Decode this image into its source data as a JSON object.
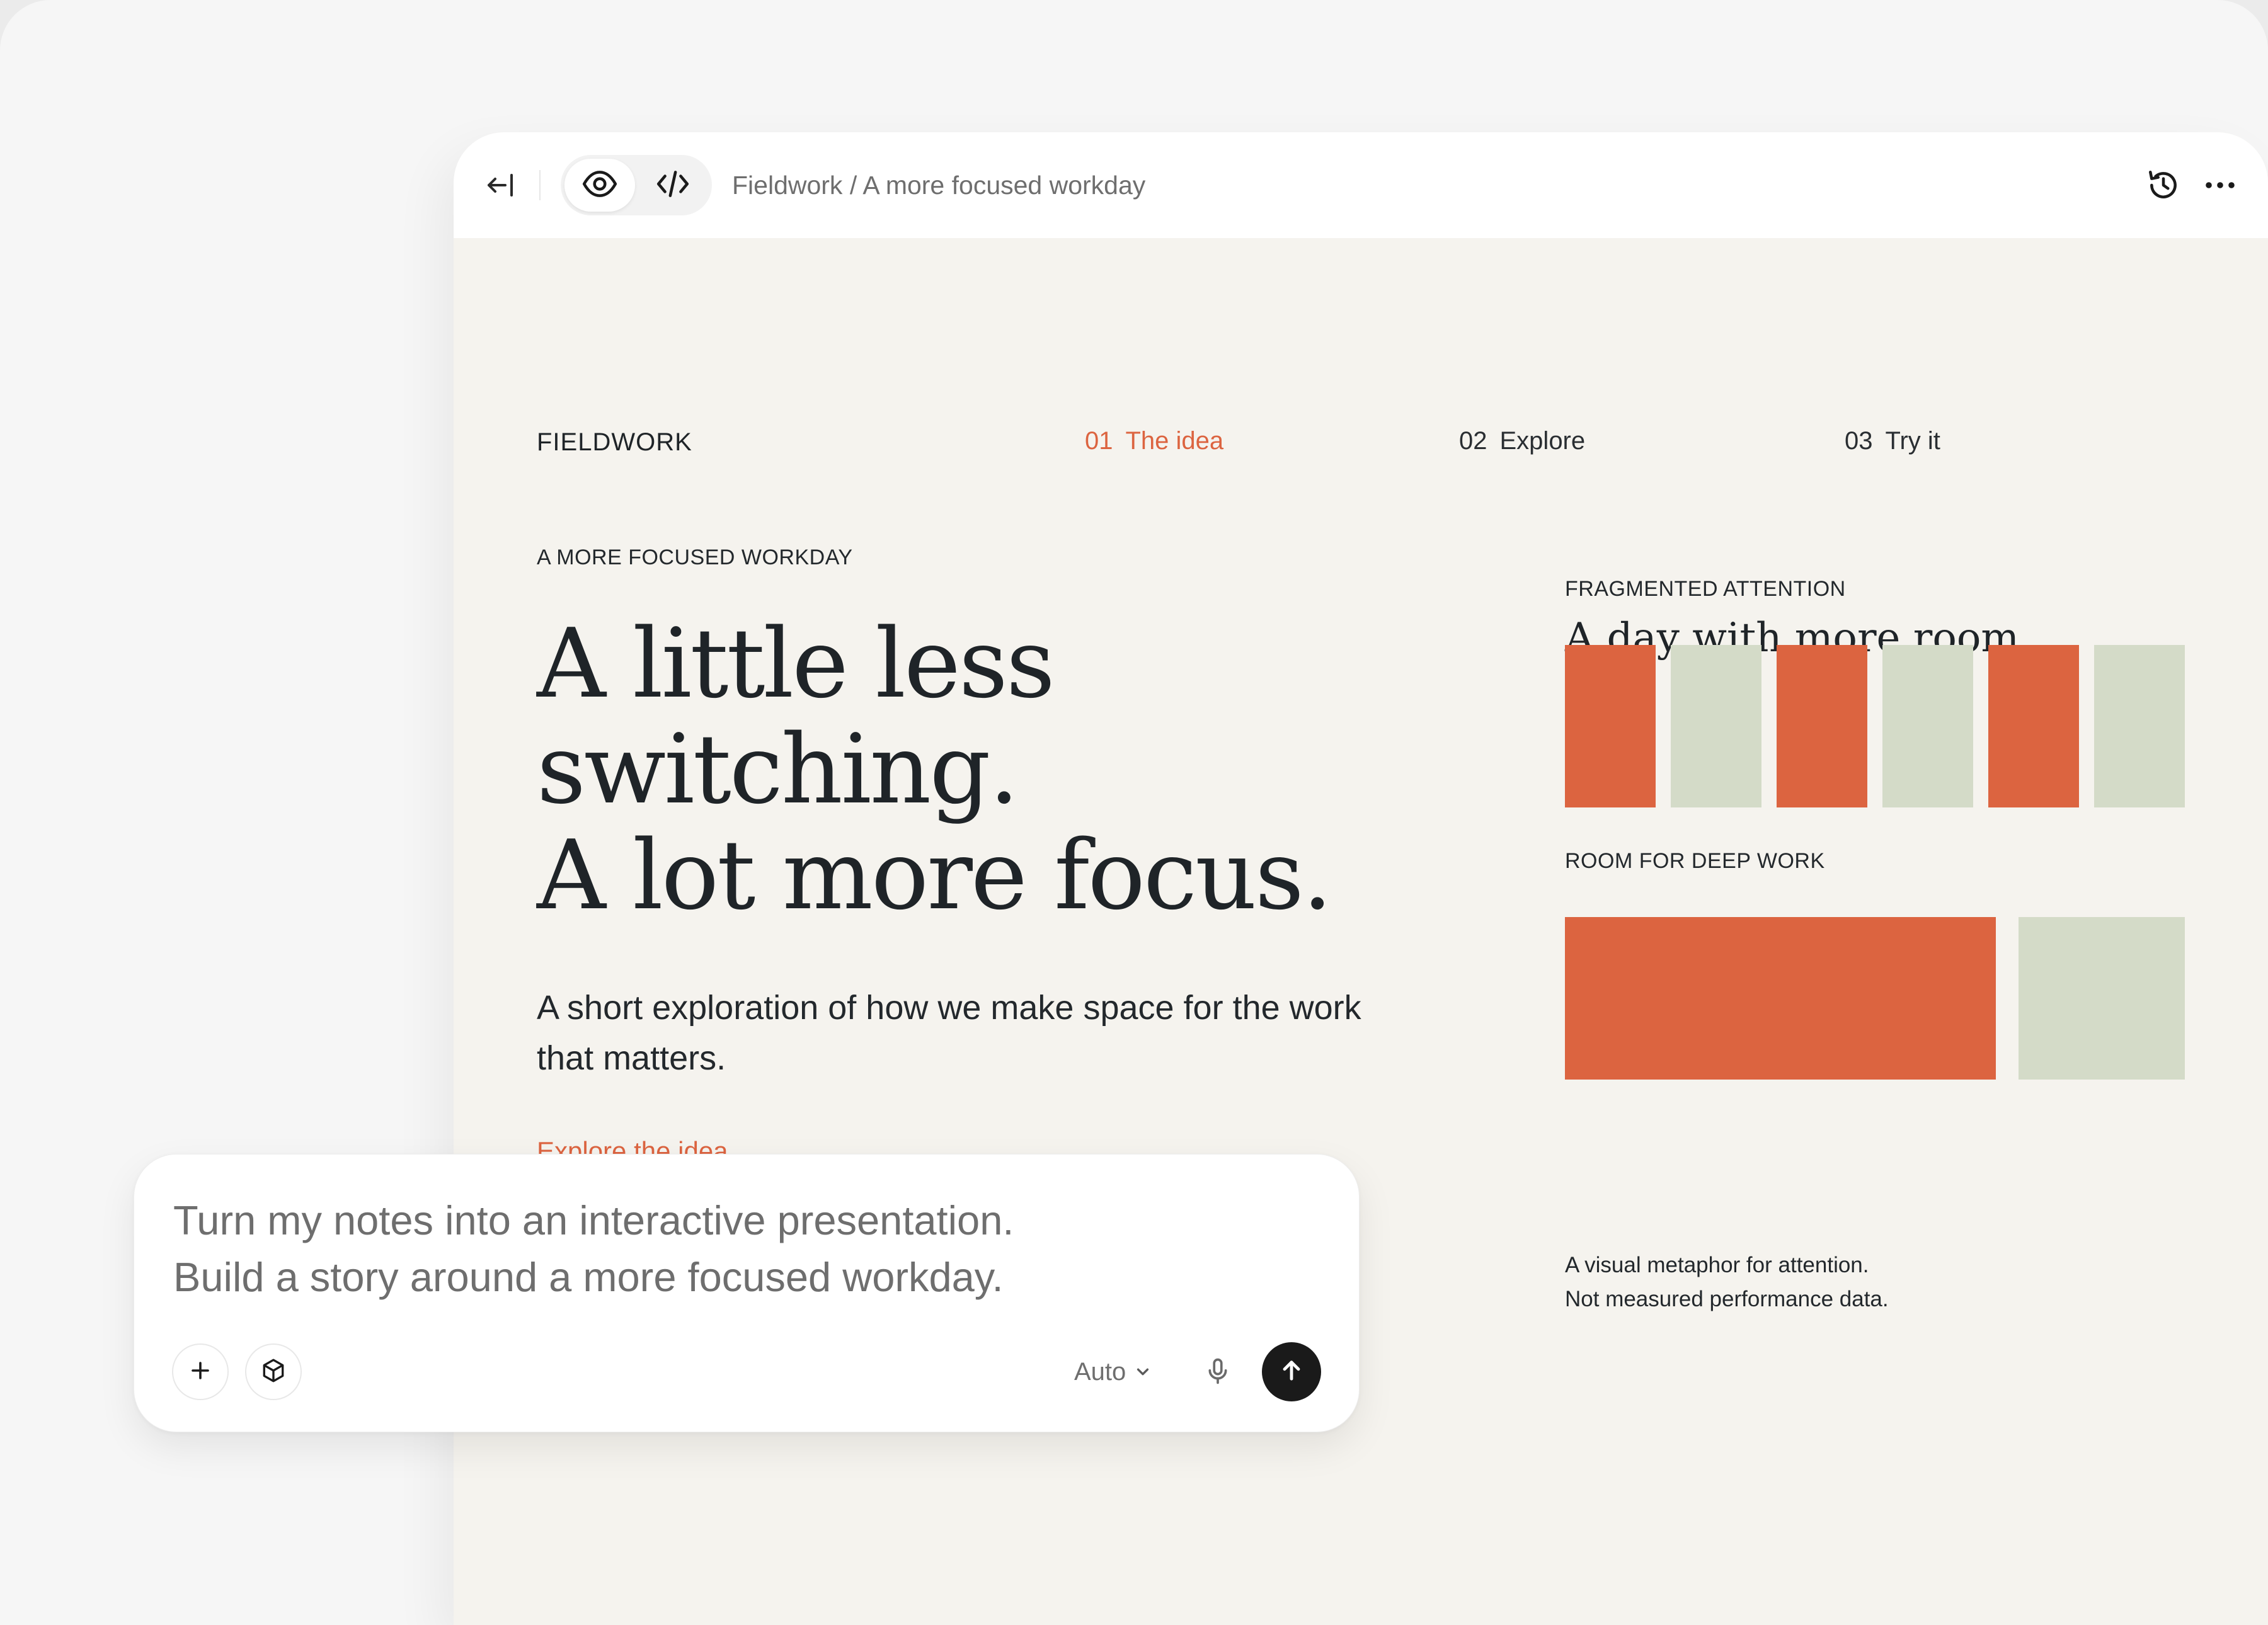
{
  "toolbar": {
    "breadcrumb": "Fieldwork / A more focused workday",
    "icons": [
      "collapse-sidebar-icon",
      "eye-icon",
      "code-icon",
      "history-icon",
      "more-icon"
    ]
  },
  "page": {
    "brand": "FIELDWORK",
    "nav": [
      {
        "num": "01",
        "label": "The idea",
        "active": true
      },
      {
        "num": "02",
        "label": "Explore",
        "active": false
      },
      {
        "num": "03",
        "label": "Try it",
        "active": false
      }
    ],
    "eyebrow": "A MORE FOCUSED WORKDAY",
    "headline": [
      "A little less",
      "switching.",
      "A lot more focus."
    ],
    "lede": "A short exploration of how we make space for the work that matters.",
    "cta": "Explore the idea",
    "side": {
      "title": "A day with more room",
      "fragmented_label": "FRAGMENTED ATTENTION",
      "deep_label": "ROOM FOR DEEP WORK",
      "note": [
        "A visual metaphor for attention.",
        "Not measured performance data."
      ]
    }
  },
  "prompt": {
    "text": [
      "Turn my notes into an interactive presentation.",
      "Build a story around a more focused workday."
    ],
    "mode": "Auto",
    "icons": [
      "plus-icon",
      "cube-icon",
      "chevron-down-icon",
      "microphone-icon",
      "arrow-up-icon"
    ]
  },
  "colors": {
    "accent": "#dc6440",
    "sage": "#d4dbc8",
    "canvas": "#f5f3ee",
    "ink": "#1f2428"
  }
}
